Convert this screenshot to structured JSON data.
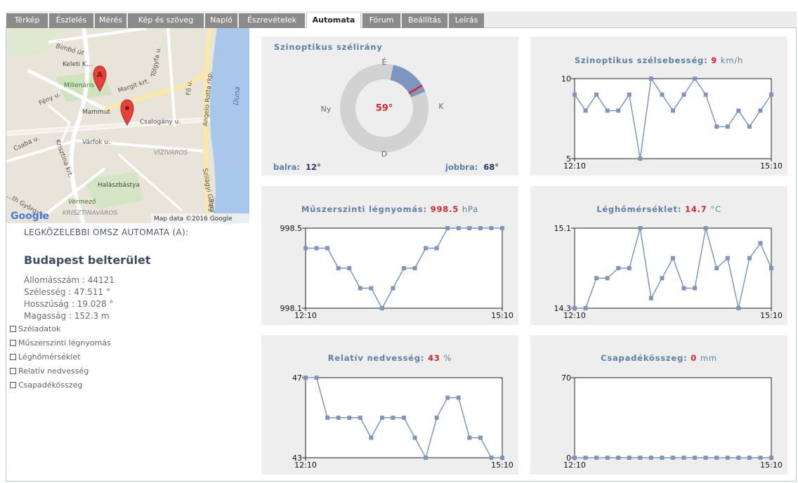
{
  "tabs": [
    {
      "label": "Térkép",
      "active": false
    },
    {
      "label": "Észlelés",
      "active": false
    },
    {
      "label": "Mérés",
      "active": false
    },
    {
      "label": "Kép és szöveg",
      "active": false
    },
    {
      "label": "Napló",
      "active": false
    },
    {
      "label": "Észrevételek",
      "active": false
    },
    {
      "label": "Automata",
      "active": true
    },
    {
      "label": "Fórum",
      "active": false
    },
    {
      "label": "Beállítás",
      "active": false
    },
    {
      "label": "Leírás",
      "active": false
    }
  ],
  "map": {
    "labels": {
      "bimbo": "Bimbó út",
      "keleti": "Keleti K...",
      "millenaris": "Millenáris",
      "margit": "Margit krt.",
      "tolgyfa": "Tölgyfa u.",
      "fenyu": "Fény u.",
      "mammut": "Mammut",
      "csalogany": "Csalogány u.",
      "angelo": "Angelo Rotta rkp.",
      "duna": "Duna",
      "csaba": "Csaba u.",
      "krisztina": "Krisztina krt.",
      "varfok": "Várfok u.",
      "vizivaros": "VÍZIVÁROS",
      "szilagyi": "Szilágyi Gábor rkp.",
      "halaszbastya": "Halászbástya",
      "vermezo": "Vérmező",
      "gyorgy": "...th György u.",
      "krisztinavaros": "KRISZTINAVÁROS",
      "fou1": "Fő u.",
      "fou2": "Fő u.",
      "marker_letter": "A"
    },
    "google_logo": "Google",
    "attribution": "Map data ©2016 Google"
  },
  "station": {
    "nearest_label": "LEGKÖZELEBBI OMSZ AUTOMATA (A):",
    "name": "Budapest belterület",
    "id_line": "Állomásszám : 44121",
    "lat_line": "Szélesség : 47.511 °",
    "lon_line": "Hosszúság : 19.028 °",
    "alt_line": "Magasság : 152.3 m"
  },
  "checkboxes": [
    {
      "label": "Széladatok",
      "checked": false
    },
    {
      "label": "Műszerszinti légnyomás",
      "checked": false
    },
    {
      "label": "Léghőmérséklet",
      "checked": false
    },
    {
      "label": "Relatív nedvesség",
      "checked": false
    },
    {
      "label": "Csapadékösszeg",
      "checked": false
    }
  ],
  "wind": {
    "title": "Szinoptikus szélirány",
    "direction_value": "59°",
    "north": "É",
    "south": "D",
    "east": "K",
    "west": "Ny",
    "left_label": "balra:",
    "left_value": "12°",
    "right_label": "jobbra:",
    "right_value": "68°"
  },
  "colors": {
    "accent_red": "#d7262b",
    "series": "#7e96bd",
    "title_blue": "#5c7fa5",
    "panel_bg": "#eeeeee",
    "tab_inactive": "#8b8b8b"
  },
  "chart_data": [
    {
      "id": "speed",
      "type": "line",
      "title_prefix": "Szinoptikus szélsebesség:",
      "title_value": "9",
      "title_unit": "km/h",
      "ymin": 5,
      "ymax": 10,
      "ymin_label": "5",
      "ymax_label": "10",
      "x_start": "12:10",
      "x_end": "15:10",
      "values": [
        9,
        8,
        9,
        8,
        8,
        9,
        5,
        10,
        9,
        8,
        9,
        10,
        9,
        7,
        7,
        8,
        7,
        8,
        9
      ]
    },
    {
      "id": "pressure",
      "type": "line",
      "title_prefix": "Műszerszinti légnyomás:",
      "title_value": "998.5",
      "title_unit": "hPa",
      "ymin": 998.1,
      "ymax": 998.5,
      "ymin_label": "998.1",
      "ymax_label": "998.5",
      "x_start": "12:10",
      "x_end": "15:10",
      "values": [
        998.4,
        998.4,
        998.4,
        998.3,
        998.3,
        998.2,
        998.2,
        998.1,
        998.2,
        998.3,
        998.3,
        998.4,
        998.4,
        998.5,
        998.5,
        998.5,
        998.5,
        998.5,
        998.5
      ]
    },
    {
      "id": "temperature",
      "type": "line",
      "title_prefix": "Léghőmérséklet:",
      "title_value": "14.7",
      "title_unit": "°C",
      "ymin": 14.3,
      "ymax": 15.1,
      "ymin_label": "14.3",
      "ymax_label": "15.1",
      "x_start": "12:10",
      "x_end": "15:10",
      "values": [
        14.3,
        14.3,
        14.6,
        14.6,
        14.7,
        14.7,
        15.1,
        14.4,
        14.6,
        14.8,
        14.5,
        14.5,
        15.1,
        14.7,
        14.8,
        14.3,
        14.8,
        14.95,
        14.7
      ]
    },
    {
      "id": "humidity",
      "type": "line",
      "title_prefix": "Relatív nedvesség:",
      "title_value": "43",
      "title_unit": "%",
      "ymin": 43,
      "ymax": 47,
      "ymin_label": "43",
      "ymax_label": "47",
      "x_start": "12:10",
      "x_end": "15:10",
      "values": [
        47,
        47,
        45,
        45,
        45,
        45,
        44,
        45,
        45,
        45,
        44,
        43,
        45,
        46,
        46,
        44,
        44,
        43,
        43
      ]
    },
    {
      "id": "precip",
      "type": "line",
      "title_prefix": "Csapadékösszeg:",
      "title_value": "0",
      "title_unit": "mm",
      "ymin": 0,
      "ymax": 70,
      "ymin_label": "0",
      "ymax_label": "70",
      "x_start": "12:10",
      "x_end": "15:10",
      "values": [
        0,
        0,
        0,
        0,
        0,
        0,
        0,
        0,
        0,
        0,
        0,
        0,
        0,
        0,
        0,
        0,
        0,
        0,
        0
      ]
    }
  ]
}
